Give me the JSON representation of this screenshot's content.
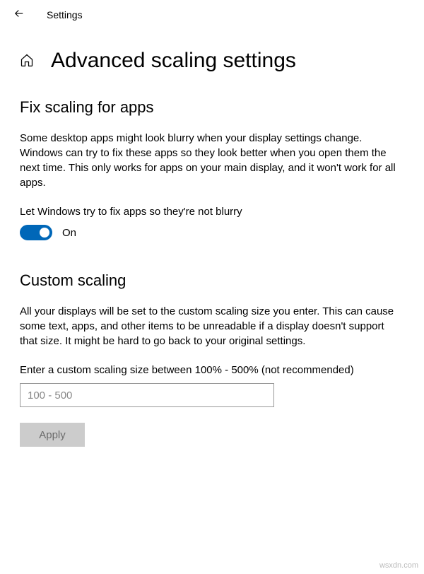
{
  "header": {
    "app_title": "Settings"
  },
  "page": {
    "title": "Advanced scaling settings"
  },
  "section1": {
    "title": "Fix scaling for apps",
    "description": "Some desktop apps might look blurry when your display settings change. Windows can try to fix these apps so they look better when you open them the next time. This only works for apps on your main display, and it won't work for all apps.",
    "toggle_label": "Let Windows try to fix apps so they're not blurry",
    "toggle_state": "On"
  },
  "section2": {
    "title": "Custom scaling",
    "description": "All your displays will be set to the custom scaling size you enter. This can cause some text, apps, and other items to be unreadable if a display doesn't support that size. It might be hard to go back to your original settings.",
    "input_label": "Enter a custom scaling size between 100% - 500% (not recommended)",
    "input_placeholder": "100 - 500",
    "apply_label": "Apply"
  },
  "watermark": "wsxdn.com"
}
